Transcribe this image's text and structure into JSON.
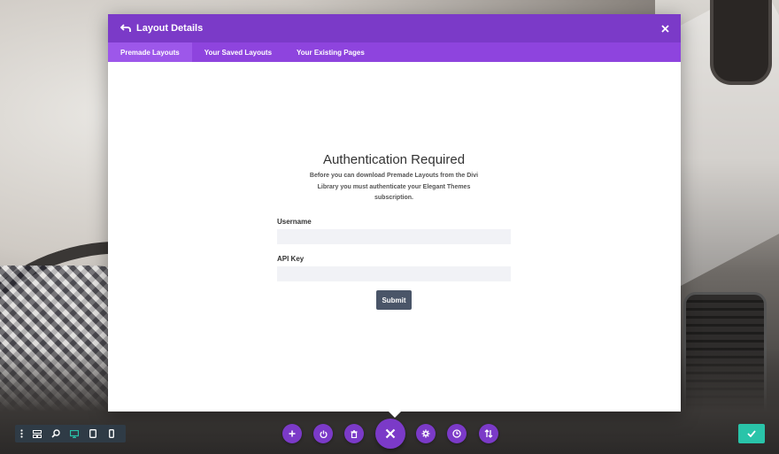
{
  "modal": {
    "title": "Layout Details",
    "tabs": [
      {
        "label": "Premade Layouts",
        "active": true
      },
      {
        "label": "Your Saved Layouts",
        "active": false
      },
      {
        "label": "Your Existing Pages",
        "active": false
      }
    ]
  },
  "auth": {
    "heading": "Authentication Required",
    "description": "Before you can download Premade Layouts from the Divi Library you must authenticate your Elegant Themes subscription.",
    "username_label": "Username",
    "username_value": "",
    "api_key_label": "API Key",
    "api_key_value": "",
    "submit_label": "Submit"
  },
  "view_bar": {
    "items": [
      "menu-icon",
      "wireframe-icon",
      "zoom-icon",
      "desktop-icon",
      "tablet-icon",
      "phone-icon"
    ],
    "active": "desktop-icon"
  },
  "actions": [
    "add-icon",
    "power-icon",
    "trash-icon",
    "close-icon",
    "gear-icon",
    "history-icon",
    "sort-icon"
  ],
  "colors": {
    "header": "#7b3ac8",
    "tabs": "#8e44de",
    "tab_active": "#9d57ea",
    "submit": "#4a5568",
    "save": "#29c4a9",
    "view_bar": "#2f3b46"
  }
}
